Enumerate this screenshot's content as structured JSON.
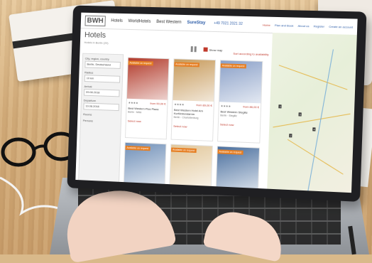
{
  "site": {
    "logo": "BWH",
    "logo_name": "Hotels",
    "brands": [
      "WorldHotels",
      "Best Western",
      "SureStay"
    ],
    "phone": "+49 7021 2021 32",
    "nav": [
      "Home",
      "Plan and Book",
      "About us",
      "Register",
      "Create an account"
    ]
  },
  "page": {
    "title": "Hotels",
    "subtitle": "Hotels in Berlin (20)",
    "sort_label": "Sort according to availability",
    "show_map_label": "Show map"
  },
  "sidebar": {
    "destination_label": "City, region, country",
    "destination_value": "Berlin, Deutschland",
    "radius_label": "Radius",
    "radius_value": "10 km",
    "arrival_label": "Arrival",
    "arrival_value": "09.08.2018",
    "departure_label": "Departure",
    "departure_value": "10.08.2018",
    "rooms_label": "Rooms",
    "persons_label": "Persons"
  },
  "hotels": [
    {
      "tag": "Available on request",
      "stars": "★★★★",
      "price": "from 99,00 €",
      "name": "Best Western Plus Plaza",
      "address": "Berlin · Mitte",
      "select": "Select now",
      "color": "#b23a2a"
    },
    {
      "tag": "Available on request",
      "stars": "★★★★",
      "price": "from 89,00 €",
      "name": "Best Western Hotel Am Kurfürstendamm",
      "address": "Berlin · Charlottenburg",
      "select": "Select now",
      "color": "#c79a5a"
    },
    {
      "tag": "Available on request",
      "stars": "★★★★",
      "price": "from 86,00 €",
      "name": "Best Western Steglitz",
      "address": "Berlin · Steglitz",
      "select": "Select now",
      "color": "#8aa0c8"
    },
    {
      "tag": "Available on request",
      "color": "#6f8fb8"
    },
    {
      "tag": "Available on request",
      "color": "#e2c79a"
    },
    {
      "tag": "Available on request",
      "color": "#4a6f9e"
    }
  ],
  "map": {
    "pins": [
      "3",
      "5",
      "2",
      "4"
    ]
  },
  "colors": {
    "accent": "#c0392b",
    "orange_tag": "#e67e22",
    "brand_blue": "#2d5da8"
  }
}
